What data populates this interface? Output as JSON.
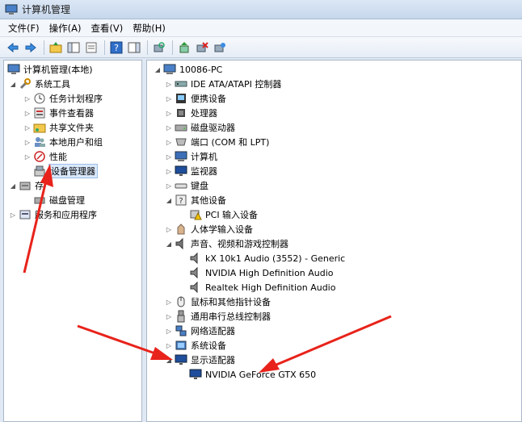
{
  "window": {
    "title": "计算机管理"
  },
  "menu": [
    {
      "label": "文件(F)"
    },
    {
      "label": "操作(A)"
    },
    {
      "label": "查看(V)"
    },
    {
      "label": "帮助(H)"
    }
  ],
  "left_tree": [
    {
      "label": "计算机管理(本地)",
      "icon": "computer-management-icon",
      "expander": ""
    },
    {
      "label": "系统工具",
      "icon": "tools-icon",
      "expander": "◢"
    },
    {
      "label": "任务计划程序",
      "icon": "clock-icon",
      "expander": "▷"
    },
    {
      "label": "事件查看器",
      "icon": "event-viewer-icon",
      "expander": "▷"
    },
    {
      "label": "共享文件夹",
      "icon": "shared-folder-icon",
      "expander": "▷"
    },
    {
      "label": "本地用户和组",
      "icon": "users-icon",
      "expander": "▷"
    },
    {
      "label": "性能",
      "icon": "performance-icon",
      "expander": "▷"
    },
    {
      "label": "设备管理器",
      "icon": "device-manager-icon",
      "expander": ""
    },
    {
      "label": "存",
      "icon": "storage-icon",
      "expander": "◢"
    },
    {
      "label": "磁盘管理",
      "icon": "disk-icon",
      "expander": ""
    },
    {
      "label": "服务和应用程序",
      "icon": "services-icon",
      "expander": "▷"
    }
  ],
  "right_tree": {
    "root": "10086-PC",
    "items": [
      {
        "label": "IDE ATA/ATAPI 控制器",
        "icon": "ide-controller-icon",
        "expander": "▷"
      },
      {
        "label": "便携设备",
        "icon": "portable-device-icon",
        "expander": "▷"
      },
      {
        "label": "处理器",
        "icon": "processor-icon",
        "expander": "▷"
      },
      {
        "label": "磁盘驱动器",
        "icon": "disk-drive-icon",
        "expander": "▷"
      },
      {
        "label": "端口 (COM 和 LPT)",
        "icon": "port-icon",
        "expander": "▷"
      },
      {
        "label": "计算机",
        "icon": "computer-icon",
        "expander": "▷"
      },
      {
        "label": "监视器",
        "icon": "monitor-icon",
        "expander": "▷"
      },
      {
        "label": "键盘",
        "icon": "keyboard-icon",
        "expander": "▷"
      },
      {
        "label": "其他设备",
        "icon": "other-device-icon",
        "expander": "◢"
      },
      {
        "label": "PCI 输入设备",
        "icon": "warning-device-icon",
        "expander": "",
        "child": true
      },
      {
        "label": "人体学输入设备",
        "icon": "hid-icon",
        "expander": "▷"
      },
      {
        "label": "声音、视频和游戏控制器",
        "icon": "sound-icon",
        "expander": "◢"
      },
      {
        "label": "kX 10k1 Audio (3552) - Generic",
        "icon": "speaker-icon",
        "expander": "",
        "child": true
      },
      {
        "label": "NVIDIA High Definition Audio",
        "icon": "speaker-icon",
        "expander": "",
        "child": true
      },
      {
        "label": "Realtek High Definition Audio",
        "icon": "speaker-icon",
        "expander": "",
        "child": true
      },
      {
        "label": "鼠标和其他指针设备",
        "icon": "mouse-icon",
        "expander": "▷"
      },
      {
        "label": "通用串行总线控制器",
        "icon": "usb-icon",
        "expander": "▷"
      },
      {
        "label": "网络适配器",
        "icon": "network-icon",
        "expander": "▷"
      },
      {
        "label": "系统设备",
        "icon": "system-device-icon",
        "expander": "▷"
      },
      {
        "label": "显示适配器",
        "icon": "display-adapter-icon",
        "expander": "◢"
      },
      {
        "label": "NVIDIA GeForce GTX 650",
        "icon": "display-card-icon",
        "expander": "",
        "child": true
      }
    ]
  },
  "colors": {
    "arrow": "#e8231b",
    "selection": "#d9e8fb"
  }
}
